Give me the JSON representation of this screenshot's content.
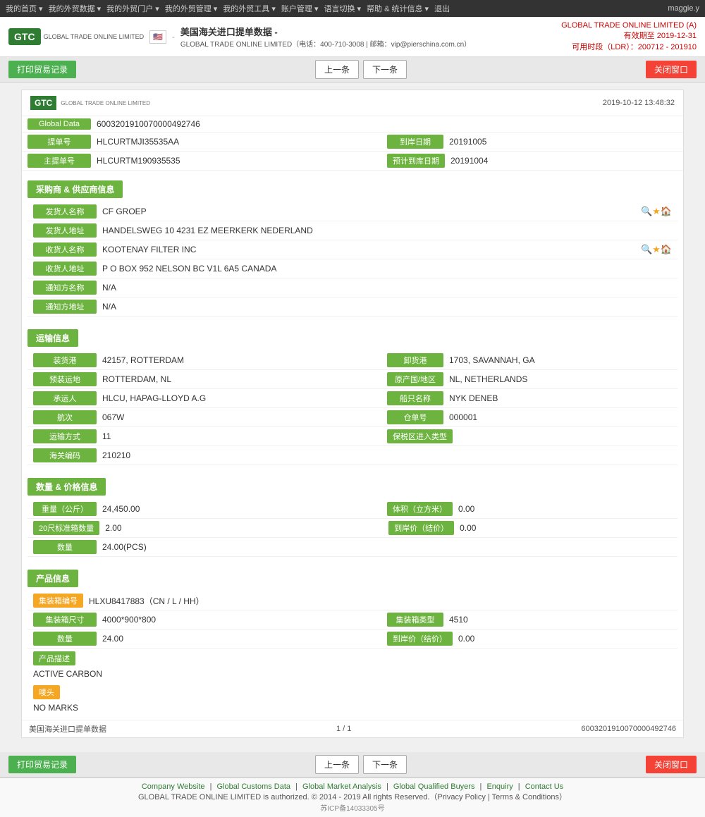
{
  "topnav": {
    "items": [
      "我的首页",
      "我的外贸数据",
      "我的外贸门户",
      "我的外贸管理",
      "我的外贸工具",
      "账户管理",
      "语言切换",
      "帮助 & 统计信息",
      "退出"
    ],
    "user": "maggie.y"
  },
  "header": {
    "logo_text": "GTC",
    "logo_sub": "GLOBAL TRADE ONLINE LIMITED",
    "flag_emoji": "🇺🇸",
    "title": "美国海关进口提单数据 -",
    "subtitle": "GLOBAL TRADE ONLINE LIMITED（电话：400-710-3008 | 邮箱：vip@pierschina.com.cn）",
    "brand": "GLOBAL TRADE ONLINE LIMITED (A)",
    "valid_until": "有效期至 2019-12-31",
    "valid_period": "可用时段（LDR）：200712 - 201910"
  },
  "toolbar": {
    "print_btn": "打印贸易记录",
    "prev_btn": "上一条",
    "next_btn": "下一条",
    "close_btn": "关闭窗口"
  },
  "doc": {
    "timestamp": "2019-10-12  13:48:32",
    "global_data_label": "Global Data",
    "global_data_value": "6003201910070000492746",
    "bill_label": "提单号",
    "bill_value": "HLCURTMJI35535AA",
    "arrival_date_label": "到岸日期",
    "arrival_date_value": "20191005",
    "master_bill_label": "主提单号",
    "master_bill_value": "HLCURTM190935535",
    "estimated_date_label": "预计到库日期",
    "estimated_date_value": "20191004",
    "sections": {
      "buyer_supplier": {
        "title": "采购商 & 供应商信息",
        "sender_name_label": "发货人名称",
        "sender_name_value": "CF GROEP",
        "sender_addr_label": "发货人地址",
        "sender_addr_value": "HANDELSWEG 10 4231 EZ MEERKERK NEDERLAND",
        "receiver_name_label": "收货人名称",
        "receiver_name_value": "KOOTENAY FILTER INC",
        "receiver_addr_label": "收货人地址",
        "receiver_addr_value": "P O BOX 952 NELSON BC V1L 6A5 CANADA",
        "notify_name_label": "通知方名称",
        "notify_name_value": "N/A",
        "notify_addr_label": "通知方地址",
        "notify_addr_value": "N/A"
      },
      "shipping": {
        "title": "运输信息",
        "departure_port_label": "装货港",
        "departure_port_value": "42157, ROTTERDAM",
        "destination_port_label": "卸货港",
        "destination_port_value": "1703, SAVANNAH, GA",
        "pre_ship_label": "预装运地",
        "pre_ship_value": "ROTTERDAM, NL",
        "origin_label": "原产国/地区",
        "origin_value": "NL, NETHERLANDS",
        "carrier_label": "承运人",
        "carrier_value": "HLCU, HAPAG-LLOYD A.G",
        "vessel_label": "船只名称",
        "vessel_value": "NYK DENEB",
        "voyage_label": "航次",
        "voyage_value": "067W",
        "warehouse_label": "仓单号",
        "warehouse_value": "000001",
        "transport_label": "运输方式",
        "transport_value": "11",
        "ftz_label": "保税区进入类型",
        "ftz_value": "",
        "customs_label": "海关编码",
        "customs_value": "210210"
      },
      "quantity_price": {
        "title": "数量 & 价格信息",
        "weight_label": "重量（公斤）",
        "weight_value": "24,450.00",
        "volume_label": "体积（立方米）",
        "volume_value": "0.00",
        "container20_label": "20尺标准箱数量",
        "container20_value": "2.00",
        "arrive_price_label": "到岸价（结价）",
        "arrive_price_value": "0.00",
        "quantity_label": "数量",
        "quantity_value": "24.00(PCS)"
      },
      "product": {
        "title": "产品信息",
        "container_no_label": "集装箱编号",
        "container_no_value": "HLXU8417883（CN / L / HH）",
        "container_size_label": "集装箱尺寸",
        "container_size_value": "4000*900*800",
        "container_type_label": "集装箱类型",
        "container_type_value": "4510",
        "quantity_label": "数量",
        "quantity_value": "24.00",
        "arrive_price_label": "到岸价（结价）",
        "arrive_price_value": "0.00",
        "desc_label": "产品描述",
        "desc_value": "ACTIVE CARBON",
        "marks_label": "唛头",
        "marks_value": "NO MARKS"
      }
    },
    "footer": {
      "source": "美国海关进口提单数据",
      "page": "1 / 1",
      "record_id": "6003201910070000492746"
    }
  },
  "page_footer": {
    "links": [
      "Company Website",
      "Global Customs Data",
      "Global Market Analysis",
      "Global Qualified Buyers",
      "Enquiry",
      "Contact Us"
    ],
    "copyright": "GLOBAL TRADE ONLINE LIMITED is authorized. © 2014 - 2019 All rights Reserved.（Privacy Policy | Terms & Conditions）",
    "icp": "苏ICP备14033305号"
  }
}
